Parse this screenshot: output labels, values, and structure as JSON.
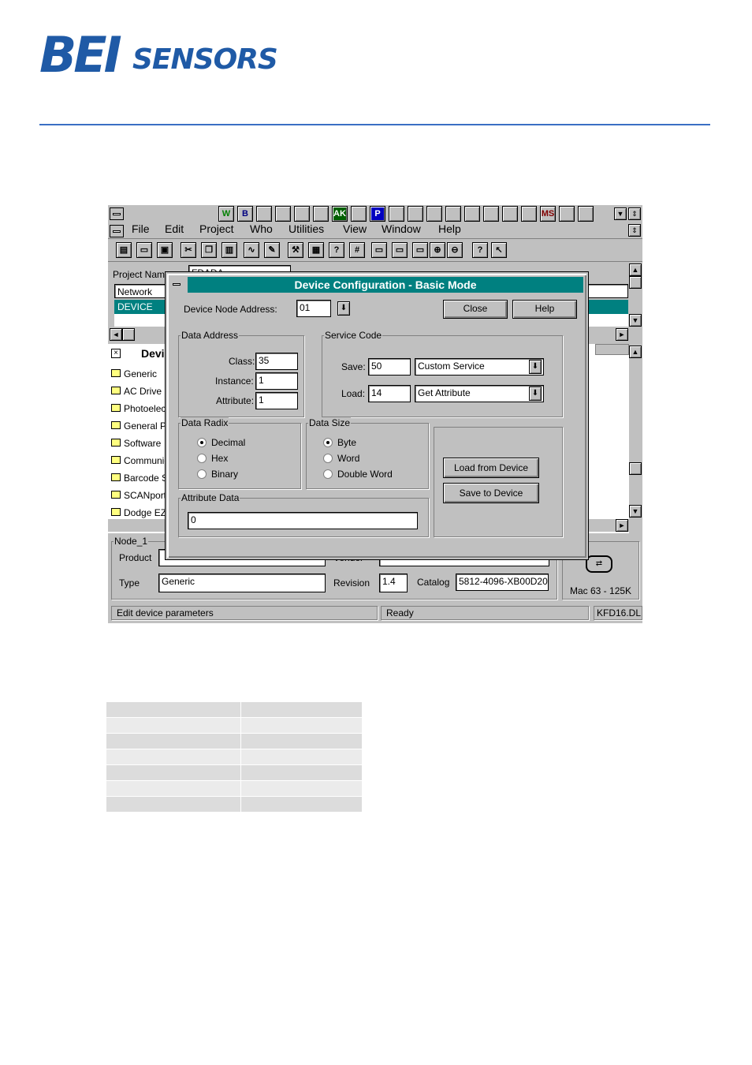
{
  "brand": {
    "bei": "BEI",
    "sensors": "SENSORS",
    "color": "#1f5aa6"
  },
  "app": {
    "toolbar_icons": [
      "W",
      "B",
      "",
      "",
      "",
      "",
      "AK",
      "",
      "P",
      "",
      "",
      "",
      "",
      "",
      "",
      "",
      "",
      "MS",
      "",
      ""
    ],
    "menu": [
      "File",
      "Edit",
      "Project",
      "Who",
      "Utilities",
      "View",
      "Window",
      "Help"
    ],
    "project_name_label": "Project Name",
    "project_name_value": "FDADA",
    "network_value": "Network",
    "device_value": "DEVICE",
    "tree_header": "Devi",
    "tree_items": [
      "Generic",
      "AC Drive",
      "Photoelect",
      "General Pu",
      "Software",
      "Communic",
      "Barcode S",
      "SCANport",
      "Dodge EZL"
    ],
    "node_group": "Node_1",
    "product_label": "Product",
    "product_value": "",
    "vendor_label": "Vendor",
    "vendor_value": "",
    "type_label": "Type",
    "type_value": "Generic",
    "revision_label": "Revision",
    "revision_value": "1.4",
    "catalog_label": "Catalog",
    "catalog_value": "5812-4096-XB00D20",
    "mac_text": "Mac 63 - 125K",
    "status_left": "Edit device parameters",
    "status_mid": "Ready",
    "status_right": "KFD16.DL"
  },
  "dialog": {
    "title": "Device Configuration - Basic Mode",
    "node_address_label": "Device Node Address:",
    "node_address_value": "01",
    "close_label": "Close",
    "help_label": "Help",
    "data_address_group": "Data Address",
    "class_label": "Class:",
    "class_value": "35",
    "instance_label": "Instance:",
    "instance_value": "1",
    "attribute_label": "Attribute:",
    "attribute_value": "1",
    "service_code_group": "Service Code",
    "save_label": "Save:",
    "save_value": "50",
    "save_service": "Custom Service",
    "load_label": "Load:",
    "load_value": "14",
    "load_service": "Get Attribute",
    "data_radix_group": "Data Radix",
    "radix_options": [
      "Decimal",
      "Hex",
      "Binary"
    ],
    "radix_selected": "Decimal",
    "data_size_group": "Data Size",
    "size_options": [
      "Byte",
      "Word",
      "Double Word"
    ],
    "size_selected": "Byte",
    "load_from_device": "Load from Device",
    "save_to_device": "Save to Device",
    "attribute_data_group": "Attribute Data",
    "attribute_data_value": "0"
  },
  "table_rows": 7
}
